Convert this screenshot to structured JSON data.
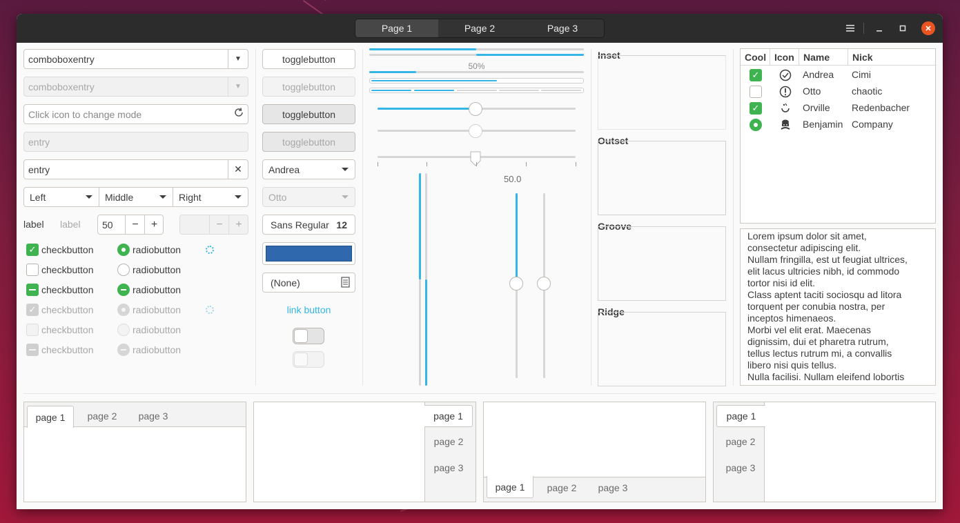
{
  "titlebar": {
    "tabs": [
      "Page 1",
      "Page 2",
      "Page 3"
    ],
    "active_tab": 0,
    "menu_icon": "hamburger-menu-icon",
    "minimize_icon": "minimize-icon",
    "maximize_icon": "maximize-icon",
    "close_icon": "close-icon",
    "close_color": "#e95420"
  },
  "entries": {
    "combo1": "comboboxentry",
    "combo2": "comboboxentry",
    "mode_placeholder": "Click icon to change mode",
    "entry_disabled": "entry",
    "entry_clear": "entry"
  },
  "segmented": [
    "Left",
    "Middle",
    "Right"
  ],
  "labels": {
    "label1": "label",
    "label2": "label"
  },
  "spin": {
    "value": "50",
    "minus": "−",
    "plus": "+"
  },
  "checks": {
    "checkbutton": "checkbutton",
    "radiobutton": "radiobutton"
  },
  "buttons": {
    "toggle": "togglebutton",
    "combo_andrea": "Andrea",
    "combo_otto": "Otto",
    "font_name": "Sans Regular",
    "font_size": "12",
    "color": "#2f68ad",
    "file_none": "(None)",
    "link": "link button"
  },
  "progress": {
    "label": "50%",
    "value": 0.5
  },
  "scales": {
    "value_label": "50.0"
  },
  "frames": [
    "Inset",
    "Outset",
    "Groove",
    "Ridge"
  ],
  "tree": {
    "headers": [
      "Cool",
      "Icon",
      "Name",
      "Nick"
    ],
    "rows": [
      {
        "cool": "checked",
        "icon": "check-circle-icon",
        "name": "Andrea",
        "nick": "Cimi"
      },
      {
        "cool": "unchecked",
        "icon": "alert-circle-icon",
        "name": "Otto",
        "nick": "chaotic"
      },
      {
        "cool": "checked",
        "icon": "moon-face-icon",
        "name": "Orville",
        "nick": "Redenbacher"
      },
      {
        "cool": "radio",
        "icon": "chef-icon",
        "name": "Benjamin",
        "nick": "Company"
      }
    ]
  },
  "textview": {
    "lines": [
      "Lorem ipsum dolor sit amet,",
      "consectetur adipiscing elit.",
      "Nullam fringilla, est ut feugiat ultrices,",
      "elit lacus ultricies nibh, id commodo",
      "tortor nisi id elit.",
      "Class aptent taciti sociosqu ad litora",
      "torquent per conubia nostra, per",
      "inceptos himenaeos.",
      "Morbi vel elit erat. Maecenas",
      "dignissim, dui et pharetra rutrum,",
      "tellus lectus rutrum mi, a convallis",
      "libero nisi quis tellus.",
      "Nulla facilisi. Nullam eleifend lobortis"
    ]
  },
  "notebooks": {
    "tabs": [
      "page 1",
      "page 2",
      "page 3"
    ]
  },
  "colors": {
    "accent": "#33b6e5",
    "check": "#3eb34f",
    "titlebar": "#2c2c2c"
  }
}
